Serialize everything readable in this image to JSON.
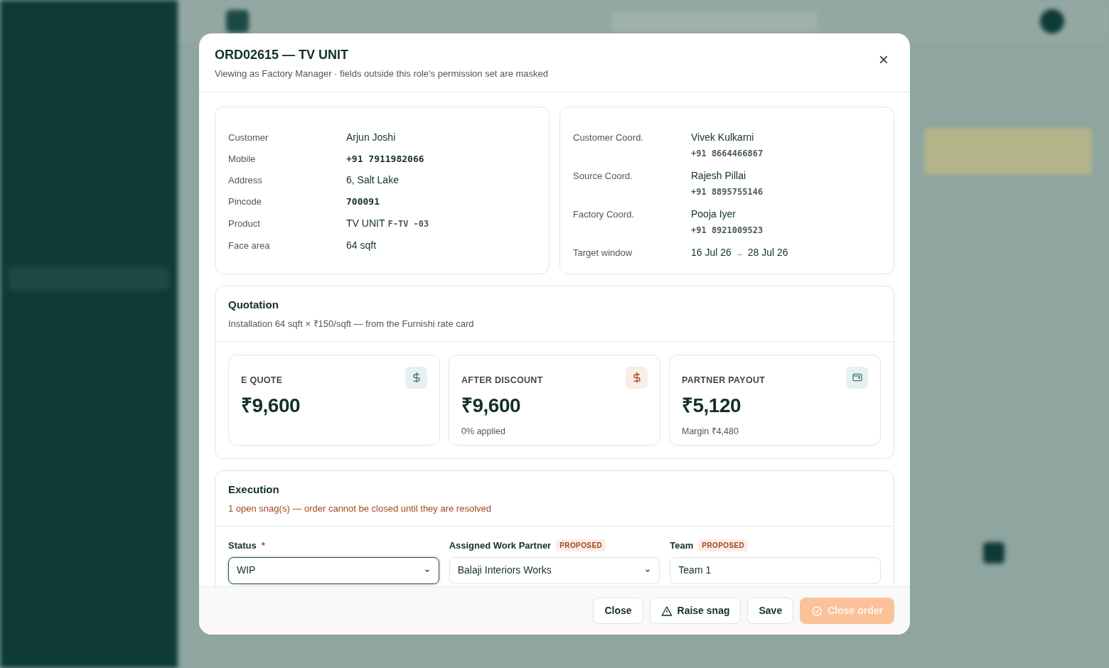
{
  "dialog": {
    "title": "ORD02615 — TV UNIT",
    "subtitle": "Viewing as Factory Manager · fields outside this role's permission set are masked",
    "close_icon": "×"
  },
  "order_details": [
    {
      "label": "Customer",
      "value": "Arjun Joshi",
      "kind": "text"
    },
    {
      "label": "Mobile",
      "value": "+91 7911982066",
      "kind": "mono"
    },
    {
      "label": "Address",
      "value": "6, Salt Lake",
      "kind": "text"
    },
    {
      "label": "Pincode",
      "value": "700091",
      "kind": "mono"
    },
    {
      "label": "Product",
      "value": "TV UNIT",
      "code": "F-TV -03",
      "kind": "product"
    },
    {
      "label": "Face area",
      "value": "64 sqft",
      "kind": "text"
    }
  ],
  "coordinators": [
    {
      "label": "Customer Coord.",
      "name": "Vivek Kulkarni",
      "phone": "+91 8664466867"
    },
    {
      "label": "Source Coord.",
      "name": "Rajesh Pillai",
      "phone": "+91 8895755146"
    },
    {
      "label": "Factory Coord.",
      "name": "Pooja Iyer",
      "phone": "+91 8921009523"
    },
    {
      "label": "Target window",
      "start": "16 Jul 26",
      "arrow": "→",
      "end": "28 Jul 26"
    }
  ],
  "quotation": {
    "title": "Quotation",
    "subtitle": "Installation 64 sqft × ₹150/sqft — from the Furnishi rate card",
    "cards": [
      {
        "label": "E QUOTE",
        "amount": "₹9,600"
      },
      {
        "label": "AFTER DISCOUNT",
        "amount": "₹9,600",
        "note": "0% applied"
      },
      {
        "label": "PARTNER PAYOUT",
        "amount": "₹5,120",
        "note": "Margin ₹4,480"
      }
    ]
  },
  "execution": {
    "title": "Execution",
    "warning": "1 open snag(s) — order cannot be closed until they are resolved",
    "fields": [
      {
        "label": "Status",
        "required_mark": "*",
        "value": "WIP",
        "kind": "select",
        "focused": true
      },
      {
        "label": "Assigned Work Partner",
        "badge": "PROPOSED",
        "value": "Balaji Interiors Works",
        "kind": "select",
        "focused": false
      },
      {
        "label": "Team",
        "badge": "PROPOSED",
        "value": "Team 1",
        "kind": "input",
        "focused": false
      }
    ]
  },
  "footer_buttons": [
    {
      "label": "Close",
      "kind": "outline",
      "disabled": false
    },
    {
      "label": "Raise snag",
      "kind": "outline",
      "disabled": false
    },
    {
      "label": "Save",
      "kind": "outline",
      "disabled": false
    },
    {
      "label": "Close order",
      "kind": "primary",
      "disabled": true
    }
  ]
}
